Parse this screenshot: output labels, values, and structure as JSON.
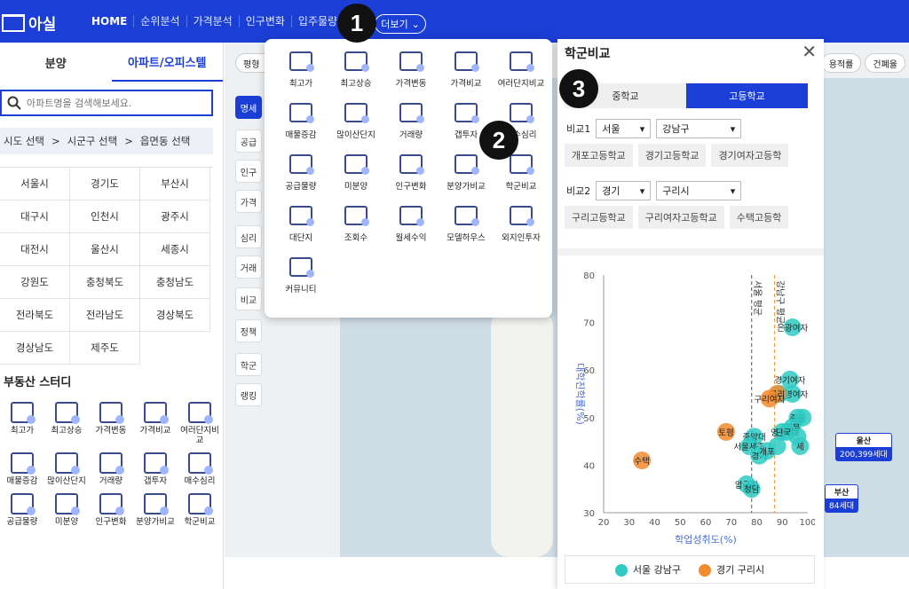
{
  "header": {
    "logo": "아실",
    "nav": [
      "HOME",
      "순위분석",
      "가격분석",
      "인구변화",
      "입주물량"
    ],
    "more": "더보기"
  },
  "left": {
    "tabs": [
      "분양",
      "아파트/오피스텔"
    ],
    "search_placeholder": "아파트명을 검색해보세요.",
    "breadcrumb": [
      "시도 선택",
      ">",
      "시군구 선택",
      ">",
      "읍면동 선택"
    ],
    "regions": [
      "서울시",
      "경기도",
      "부산시",
      "대구시",
      "인천시",
      "광주시",
      "대전시",
      "울산시",
      "세종시",
      "강원도",
      "충청북도",
      "충청남도",
      "전라북도",
      "전라남도",
      "경상북도",
      "경상남도",
      "제주도"
    ],
    "study_title": "부동산 스터디",
    "study_items": [
      "최고가",
      "최고상승",
      "가격변동",
      "가격비교",
      "여러단지비교",
      "매물증감",
      "많이산단지",
      "거래량",
      "갭투자",
      "매수심리",
      "공급물량",
      "미분양",
      "인구변화",
      "분양가비교",
      "학군비교"
    ]
  },
  "map": {
    "chip": "평형",
    "side_buttons": [
      "명세",
      "공급",
      "인구",
      "가격",
      "심리",
      "거래",
      "비교",
      "정책",
      "학군",
      "랭킹"
    ],
    "right_chips": [
      "용적률",
      "건폐율"
    ],
    "pins": [
      {
        "name": "울산",
        "count": "200,399세대"
      },
      {
        "name": "부산",
        "count": "84세대"
      }
    ]
  },
  "dropdown": {
    "items": [
      "최고가",
      "최고상승",
      "가격변동",
      "가격비교",
      "여러단지비교",
      "매물증감",
      "많이산단지",
      "거래량",
      "갭투자",
      "매수심리",
      "공급물량",
      "미분양",
      "인구변화",
      "분양가비교",
      "학군비교",
      "대단지",
      "조회수",
      "월세수익",
      "모델하우스",
      "외지인투자",
      "커뮤니티"
    ]
  },
  "panel": {
    "title": "학군비교",
    "close": "✕",
    "seg": [
      "중학교",
      "고등학교"
    ],
    "compare1": {
      "label": "비교1",
      "sido": "서울",
      "sigungu": "강남구",
      "schools": [
        "개포고등학교",
        "경기고등학교",
        "경기여자고등학"
      ]
    },
    "compare2": {
      "label": "비교2",
      "sido": "경기",
      "sigungu": "구리시",
      "schools": [
        "구리고등학교",
        "구리여자고등학교",
        "수택고등학"
      ]
    },
    "legend": [
      "서울 강남구",
      "경기 구리시"
    ]
  },
  "badges": [
    "1",
    "2",
    "3"
  ],
  "colors": {
    "brand": "#1b3fd6",
    "teal": "#2fcbc3",
    "orange": "#f28a2e"
  },
  "chart_data": {
    "type": "scatter",
    "xlabel": "학업성취도(%)",
    "ylabel": "대학진학률(%)",
    "xlim": [
      20,
      100
    ],
    "ylim": [
      30,
      80
    ],
    "xticks": [
      20,
      30,
      40,
      50,
      60,
      70,
      80,
      90,
      100
    ],
    "yticks": [
      30,
      40,
      50,
      60,
      70,
      80
    ],
    "ref_lines": [
      {
        "label": "서울 평균",
        "x": 78
      },
      {
        "label": "강남구 평균",
        "x": 87
      }
    ],
    "series": [
      {
        "name": "서울 강남구",
        "color": "#2fcbc3",
        "points": [
          {
            "label": "은광여자",
            "x": 94,
            "y": 69
          },
          {
            "label": "경기여자",
            "x": 93,
            "y": 58
          },
          {
            "label": "숙명여자",
            "x": 94,
            "y": 55
          },
          {
            "label": "",
            "x": 89,
            "y": 55
          },
          {
            "label": "중동",
            "x": 96,
            "y": 50
          },
          {
            "label": "",
            "x": 98,
            "y": 50
          },
          {
            "label": "휘문",
            "x": 94,
            "y": 48
          },
          {
            "label": "영동일",
            "x": 90,
            "y": 47
          },
          {
            "label": "단국대",
            "x": 92,
            "y": 47
          },
          {
            "label": "",
            "x": 96,
            "y": 46
          },
          {
            "label": "중앙대",
            "x": 79,
            "y": 46
          },
          {
            "label": "서울세종",
            "x": 77,
            "y": 44
          },
          {
            "label": "",
            "x": 88,
            "y": 44
          },
          {
            "label": "세",
            "x": 97,
            "y": 44
          },
          {
            "label": "경기",
            "x": 81,
            "y": 42
          },
          {
            "label": "개포",
            "x": 84,
            "y": 43
          },
          {
            "label": "압구정",
            "x": 76,
            "y": 36
          },
          {
            "label": "청담",
            "x": 78,
            "y": 35
          }
        ]
      },
      {
        "name": "경기 구리시",
        "color": "#f28a2e",
        "points": [
          {
            "label": "구리",
            "x": 88,
            "y": 55
          },
          {
            "label": "구리여자",
            "x": 85,
            "y": 54
          },
          {
            "label": "토평",
            "x": 68,
            "y": 47
          },
          {
            "label": "수택",
            "x": 35,
            "y": 41
          }
        ]
      }
    ]
  }
}
